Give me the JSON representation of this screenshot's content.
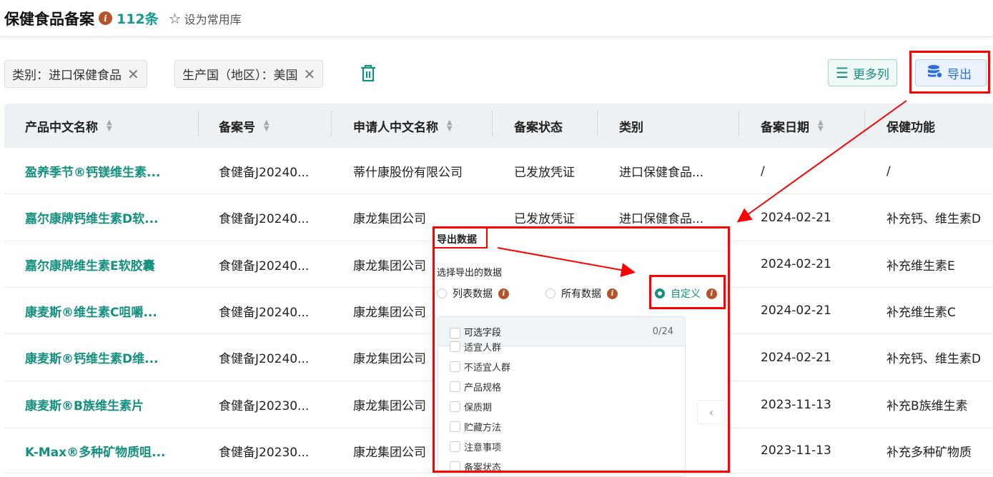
{
  "header": {
    "title": "保健食品备案",
    "count": "112条",
    "favorite_label": "设为常用库"
  },
  "filters": [
    {
      "label": "类别：进口保健食品"
    },
    {
      "label": "生产国（地区）：美国"
    }
  ],
  "toolbar": {
    "more_columns": "更多列",
    "export": "导出"
  },
  "table": {
    "columns": [
      "产品中文名称",
      "备案号",
      "申请人中文名称",
      "备案状态",
      "类别",
      "备案日期",
      "保健功能"
    ],
    "rows": [
      [
        "盈养季节®钙镁维生素...",
        "食健备J20240...",
        "蒂什康股份有限公司",
        "已发放凭证",
        "进口保健食品...",
        "/",
        "/"
      ],
      [
        "嘉尔康牌钙维生素D软...",
        "食健备J20240...",
        "康龙集团公司",
        "已发放凭证",
        "进口保健食品...",
        "2024-02-21",
        "补充钙、维生素D"
      ],
      [
        "嘉尔康牌维生素E软胶囊",
        "食健备J20240...",
        "康龙集团公司",
        "",
        "",
        "2024-02-21",
        "补充维生素E"
      ],
      [
        "康麦斯®维生素C咀嚼...",
        "食健备J20240...",
        "康龙集团公司",
        "",
        "",
        "2024-02-21",
        "补充维生素C"
      ],
      [
        "康麦斯®钙维生素D维...",
        "食健备J20240...",
        "康龙集团公司",
        "",
        "",
        "2024-02-21",
        "补充钙、维生素D"
      ],
      [
        "康麦斯®B族维生素片",
        "食健备J20230...",
        "康龙集团公司",
        "",
        "",
        "2023-11-13",
        "补充B族维生素"
      ],
      [
        "K-Max®多种矿物质咀...",
        "食健备J20230...",
        "康龙集团公司",
        "",
        "",
        "2023-11-13",
        "补充多种矿物质"
      ]
    ]
  },
  "export_popup": {
    "title": "导出数据",
    "section_label": "选择导出的数据",
    "options": [
      "列表数据",
      "所有数据",
      "自定义"
    ],
    "selected": "自定义",
    "field_list": {
      "header": "可选字段",
      "count": "0/24",
      "items": [
        "适宜人群",
        "不适宜人群",
        "产品规格",
        "保质期",
        "贮藏方法",
        "注意事项",
        "备案状态"
      ]
    }
  },
  "colors": {
    "accent": "#13907e",
    "info": "#b5532b",
    "annotation": "#ff0000"
  }
}
